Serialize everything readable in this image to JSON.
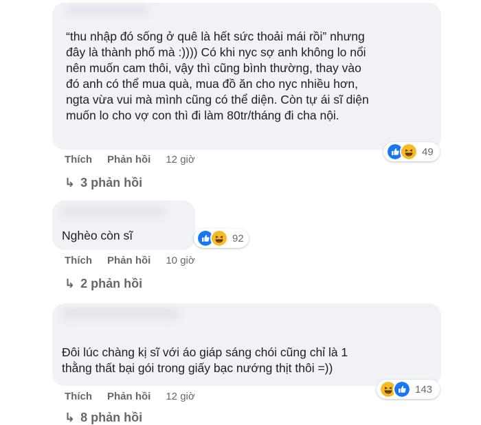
{
  "comments": [
    {
      "text": "“thu nhập đó sống ở quê là hết sức thoải mái rồi” nhưng\nđây là thành phố mà :)))) Có khi nyc sợ anh không lo nổi\nnên muốn cam thôi, vậy thì cũng bình thường, thay vào\nđó anh có thể mua quà, mua đồ ăn cho nyc nhiều hơn,\nngta vừa vui mà mình cũng có thể diện. Còn tự ái sĩ diện\nmuốn lo cho vợ con thì đi làm 80tr/tháng đi cha nội.",
      "reactions": {
        "count": "49",
        "icons": [
          "like-icon",
          "haha-icon"
        ]
      },
      "like_label": "Thích",
      "reply_label": "Phản hồi",
      "time": "12 giờ",
      "replies_label": "3 phản hồi"
    },
    {
      "text": "Nghèo còn sĩ",
      "reactions": {
        "count": "92",
        "icons": [
          "like-icon",
          "haha-icon"
        ]
      },
      "like_label": "Thích",
      "reply_label": "Phản hồi",
      "time": "10 giờ",
      "replies_label": "2 phản hồi"
    },
    {
      "text": "Đôi lúc chàng kị sĩ với áo giáp sáng chói cũng chỉ là 1\nthằng thất bại gói trong giấy bạc nướng thịt thôi =))",
      "reactions": {
        "count": "143",
        "icons": [
          "haha-icon",
          "like-icon"
        ]
      },
      "like_label": "Thích",
      "reply_label": "Phản hồi",
      "time": "12 giờ",
      "replies_label": "8 phản hồi"
    }
  ],
  "colors": {
    "bubble": "#f0f2f5",
    "meta_text": "#65676b",
    "like_blue": "#1877f2",
    "haha_yellow": "#f7b928"
  }
}
